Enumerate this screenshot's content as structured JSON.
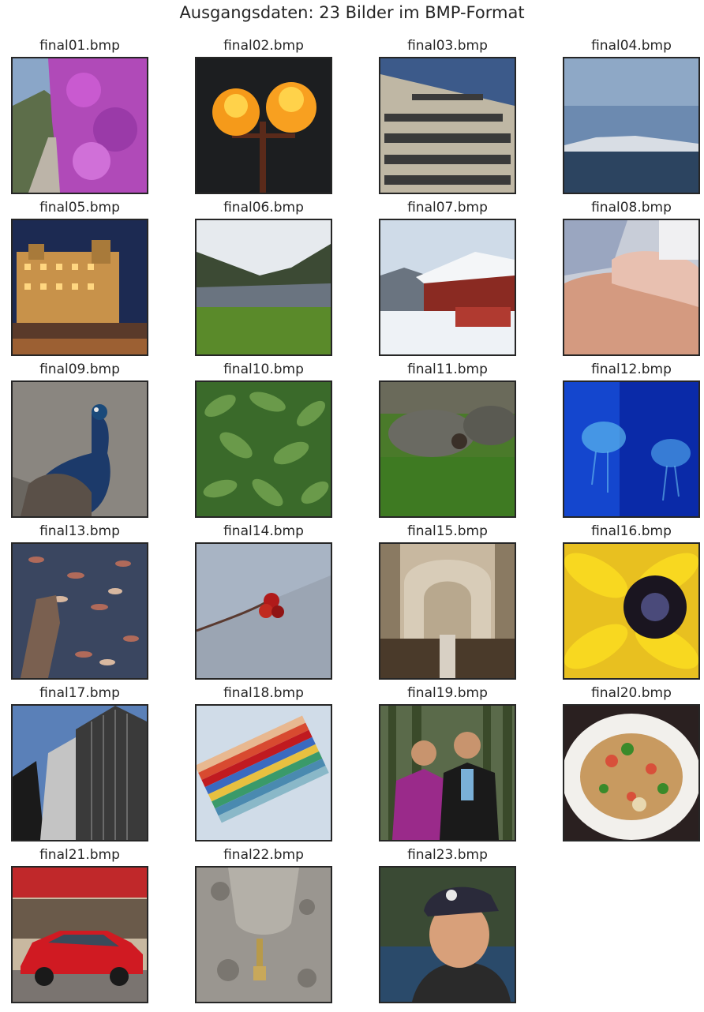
{
  "figure": {
    "title": "Ausgangsdaten: 23 Bilder im BMP-Format"
  },
  "images": [
    {
      "filename": "final01.bmp",
      "scene": "flower-wall"
    },
    {
      "filename": "final02.bmp",
      "scene": "street-lamps"
    },
    {
      "filename": "final03.bmp",
      "scene": "warning-sign"
    },
    {
      "filename": "final04.bmp",
      "scene": "sea-dusk"
    },
    {
      "filename": "final05.bmp",
      "scene": "hotel-night"
    },
    {
      "filename": "final06.bmp",
      "scene": "river-valley"
    },
    {
      "filename": "final07.bmp",
      "scene": "snow-cabin"
    },
    {
      "filename": "final08.bmp",
      "scene": "baby-hand"
    },
    {
      "filename": "final09.bmp",
      "scene": "peacock"
    },
    {
      "filename": "final10.bmp",
      "scene": "green-leaves"
    },
    {
      "filename": "final11.bmp",
      "scene": "hedgehogs"
    },
    {
      "filename": "final12.bmp",
      "scene": "jellyfish"
    },
    {
      "filename": "final13.bmp",
      "scene": "leaves-water"
    },
    {
      "filename": "final14.bmp",
      "scene": "rosehip-branch"
    },
    {
      "filename": "final15.bmp",
      "scene": "cathedral"
    },
    {
      "filename": "final16.bmp",
      "scene": "yellow-flower"
    },
    {
      "filename": "final17.bmp",
      "scene": "skyscraper"
    },
    {
      "filename": "final18.bmp",
      "scene": "color-swatches"
    },
    {
      "filename": "final19.bmp",
      "scene": "couple-forest"
    },
    {
      "filename": "final20.bmp",
      "scene": "noodle-dish"
    },
    {
      "filename": "final21.bmp",
      "scene": "red-car"
    },
    {
      "filename": "final22.bmp",
      "scene": "stone-faucet"
    },
    {
      "filename": "final23.bmp",
      "scene": "man-cap"
    }
  ]
}
